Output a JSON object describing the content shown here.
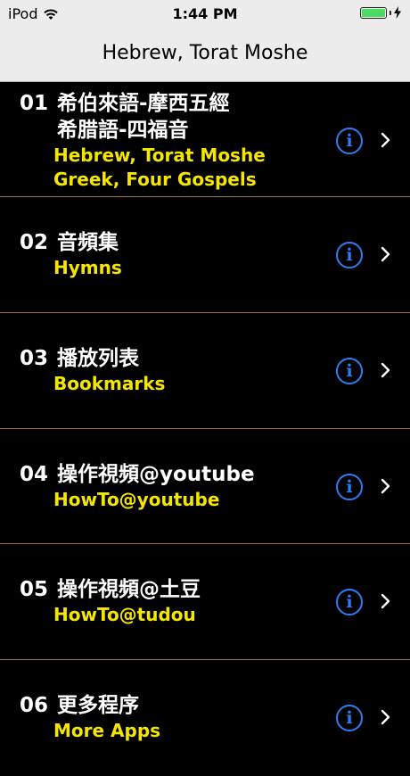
{
  "status_bar": {
    "carrier": "iPod",
    "time": "1:44 PM",
    "battery_level": 1.0,
    "icons": [
      "wifi-icon",
      "battery-icon",
      "charging-bolt-icon"
    ]
  },
  "nav": {
    "title": "Hebrew, Torat Moshe"
  },
  "colors": {
    "background": "#000000",
    "primary_text": "#ffffff",
    "secondary_text": "#f5e600",
    "accent": "#2f7cf6",
    "separator": "#a07438"
  },
  "rows": [
    {
      "number": "01",
      "title": "希伯來語-摩西五經",
      "title2": "希腊語-四福音",
      "subtitle": "Hebrew, Torat Moshe",
      "subtitle2": "Greek, Four Gospels"
    },
    {
      "number": "02",
      "title": "音頻集",
      "subtitle": "Hymns"
    },
    {
      "number": "03",
      "title": "播放列表",
      "subtitle": "Bookmarks"
    },
    {
      "number": "04",
      "title": "操作視頻@youtube",
      "subtitle": "HowTo@youtube"
    },
    {
      "number": "05",
      "title": "操作視頻@土豆",
      "subtitle": "HowTo@tudou"
    },
    {
      "number": "06",
      "title": "更多程序",
      "subtitle": "More Apps"
    }
  ]
}
